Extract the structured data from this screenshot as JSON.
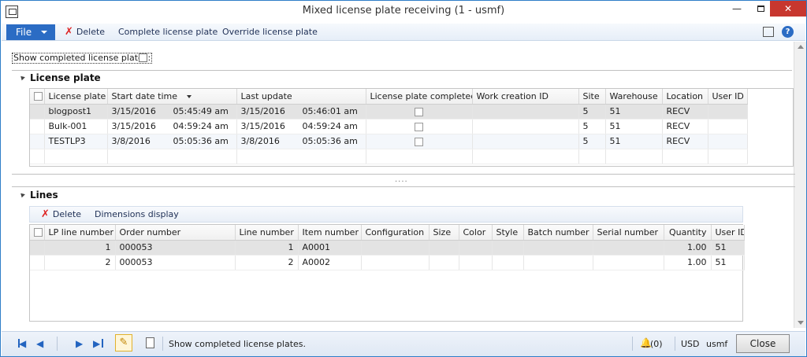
{
  "window": {
    "title": "Mixed license plate receiving (1 - usmf)"
  },
  "actions": {
    "file": "File",
    "delete": "Delete",
    "complete": "Complete license plate",
    "override": "Override license plate"
  },
  "filter": {
    "show_completed_label": "Show completed license plates:"
  },
  "license_plate": {
    "title": "License plate",
    "columns": [
      "License plate",
      "Start date time",
      "Last update",
      "License plate completed",
      "Work creation ID",
      "Site",
      "Warehouse",
      "Location",
      "User ID"
    ],
    "rows": [
      {
        "plate": "blogpost1",
        "start_date": "3/15/2016",
        "start_time": "05:45:49 am",
        "update_date": "3/15/2016",
        "update_time": "05:46:01 am",
        "work_id": "",
        "site": "5",
        "warehouse": "51",
        "location": "RECV",
        "user": ""
      },
      {
        "plate": "Bulk-001",
        "start_date": "3/15/2016",
        "start_time": "04:59:24 am",
        "update_date": "3/15/2016",
        "update_time": "04:59:24 am",
        "work_id": "",
        "site": "5",
        "warehouse": "51",
        "location": "RECV",
        "user": ""
      },
      {
        "plate": "TESTLP3",
        "start_date": "3/8/2016",
        "start_time": "05:05:36 am",
        "update_date": "3/8/2016",
        "update_time": "05:05:36 am",
        "work_id": "",
        "site": "5",
        "warehouse": "51",
        "location": "RECV",
        "user": ""
      }
    ]
  },
  "lines": {
    "title": "Lines",
    "delete": "Delete",
    "dimensions": "Dimensions display",
    "columns": [
      "LP line number",
      "Order number",
      "Line number",
      "Item number",
      "Configuration",
      "Size",
      "Color",
      "Style",
      "Batch number",
      "Serial number",
      "Quantity",
      "User ID"
    ],
    "rows": [
      {
        "lp_line": "1",
        "order": "000053",
        "line": "1",
        "item": "A0001",
        "qty": "1.00",
        "user": "51"
      },
      {
        "lp_line": "2",
        "order": "000053",
        "line": "2",
        "item": "A0002",
        "qty": "1.00",
        "user": "51"
      }
    ]
  },
  "status": {
    "text": "Show completed license plates.",
    "alerts": "(0)",
    "currency": "USD",
    "company": "usmf",
    "close": "Close"
  },
  "colors": {
    "accent": "#2b6cc4",
    "close_red": "#c7372f",
    "selected_row": "#e3e3e3"
  }
}
